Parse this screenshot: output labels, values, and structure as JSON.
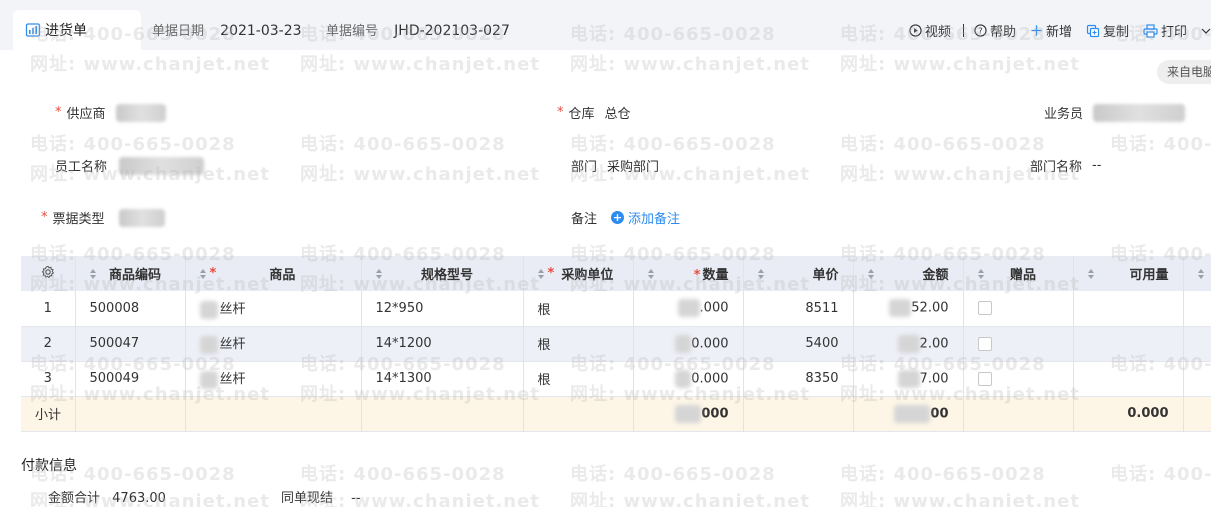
{
  "header": {
    "tab_label": "进货单",
    "date_label": "单据日期",
    "date_value": "2021-03-23",
    "number_label": "单据编号",
    "number_value": "JHD-202103-027",
    "actions": {
      "video": "视频",
      "help": "帮助",
      "add": "新增",
      "copy": "复制",
      "print": "打印"
    },
    "source_pill": "来自电脑"
  },
  "form": {
    "supplier_label": "供应商",
    "warehouse_label": "仓库",
    "warehouse_value": "总仓",
    "salesman_label": "业务员",
    "employee_label": "员工名称",
    "department_label": "部门",
    "department_value": "采购部门",
    "department_name_label": "部门名称",
    "department_name_value": "--",
    "invoice_type_label": "票据类型",
    "note_label": "备注",
    "add_note": "添加备注"
  },
  "table": {
    "columns": {
      "code": "商品编码",
      "product": "商品",
      "spec": "规格型号",
      "unit": "采购单位",
      "qty": "数量",
      "price": "单价",
      "amount": "金额",
      "gift": "赠品",
      "available": "可用量"
    },
    "rows": [
      {
        "idx": "1",
        "code": "500008",
        "product": "丝杆",
        "spec": "12*950",
        "unit": "根",
        "qty": ".000",
        "price": "8511",
        "amount": "52.00"
      },
      {
        "idx": "2",
        "code": "500047",
        "product": "丝杆",
        "spec": "14*1200",
        "unit": "根",
        "qty": "0.000",
        "price": "5400",
        "amount": "2.00"
      },
      {
        "idx": "3",
        "code": "500049",
        "product": "丝杆",
        "spec": "14*1300",
        "unit": "根",
        "qty": "0.000",
        "price": "8350",
        "amount": "7.00"
      }
    ],
    "subtotal": {
      "label": "小计",
      "qty": "000",
      "amount": "00",
      "available": "0.000"
    }
  },
  "payment": {
    "title": "付款信息",
    "total_label": "金额合计",
    "total_value": "4763.00",
    "cash_label": "同单现结",
    "cash_value": "--"
  },
  "watermark": {
    "phone": "电话: 400-665-0028",
    "site": "网址: www.chanjet.net"
  },
  "colors": {
    "accent": "#2d8cf0",
    "required": "#e74c3c",
    "subtotal_bg": "#fdf6e7",
    "header_bg": "#e9ecf4"
  }
}
